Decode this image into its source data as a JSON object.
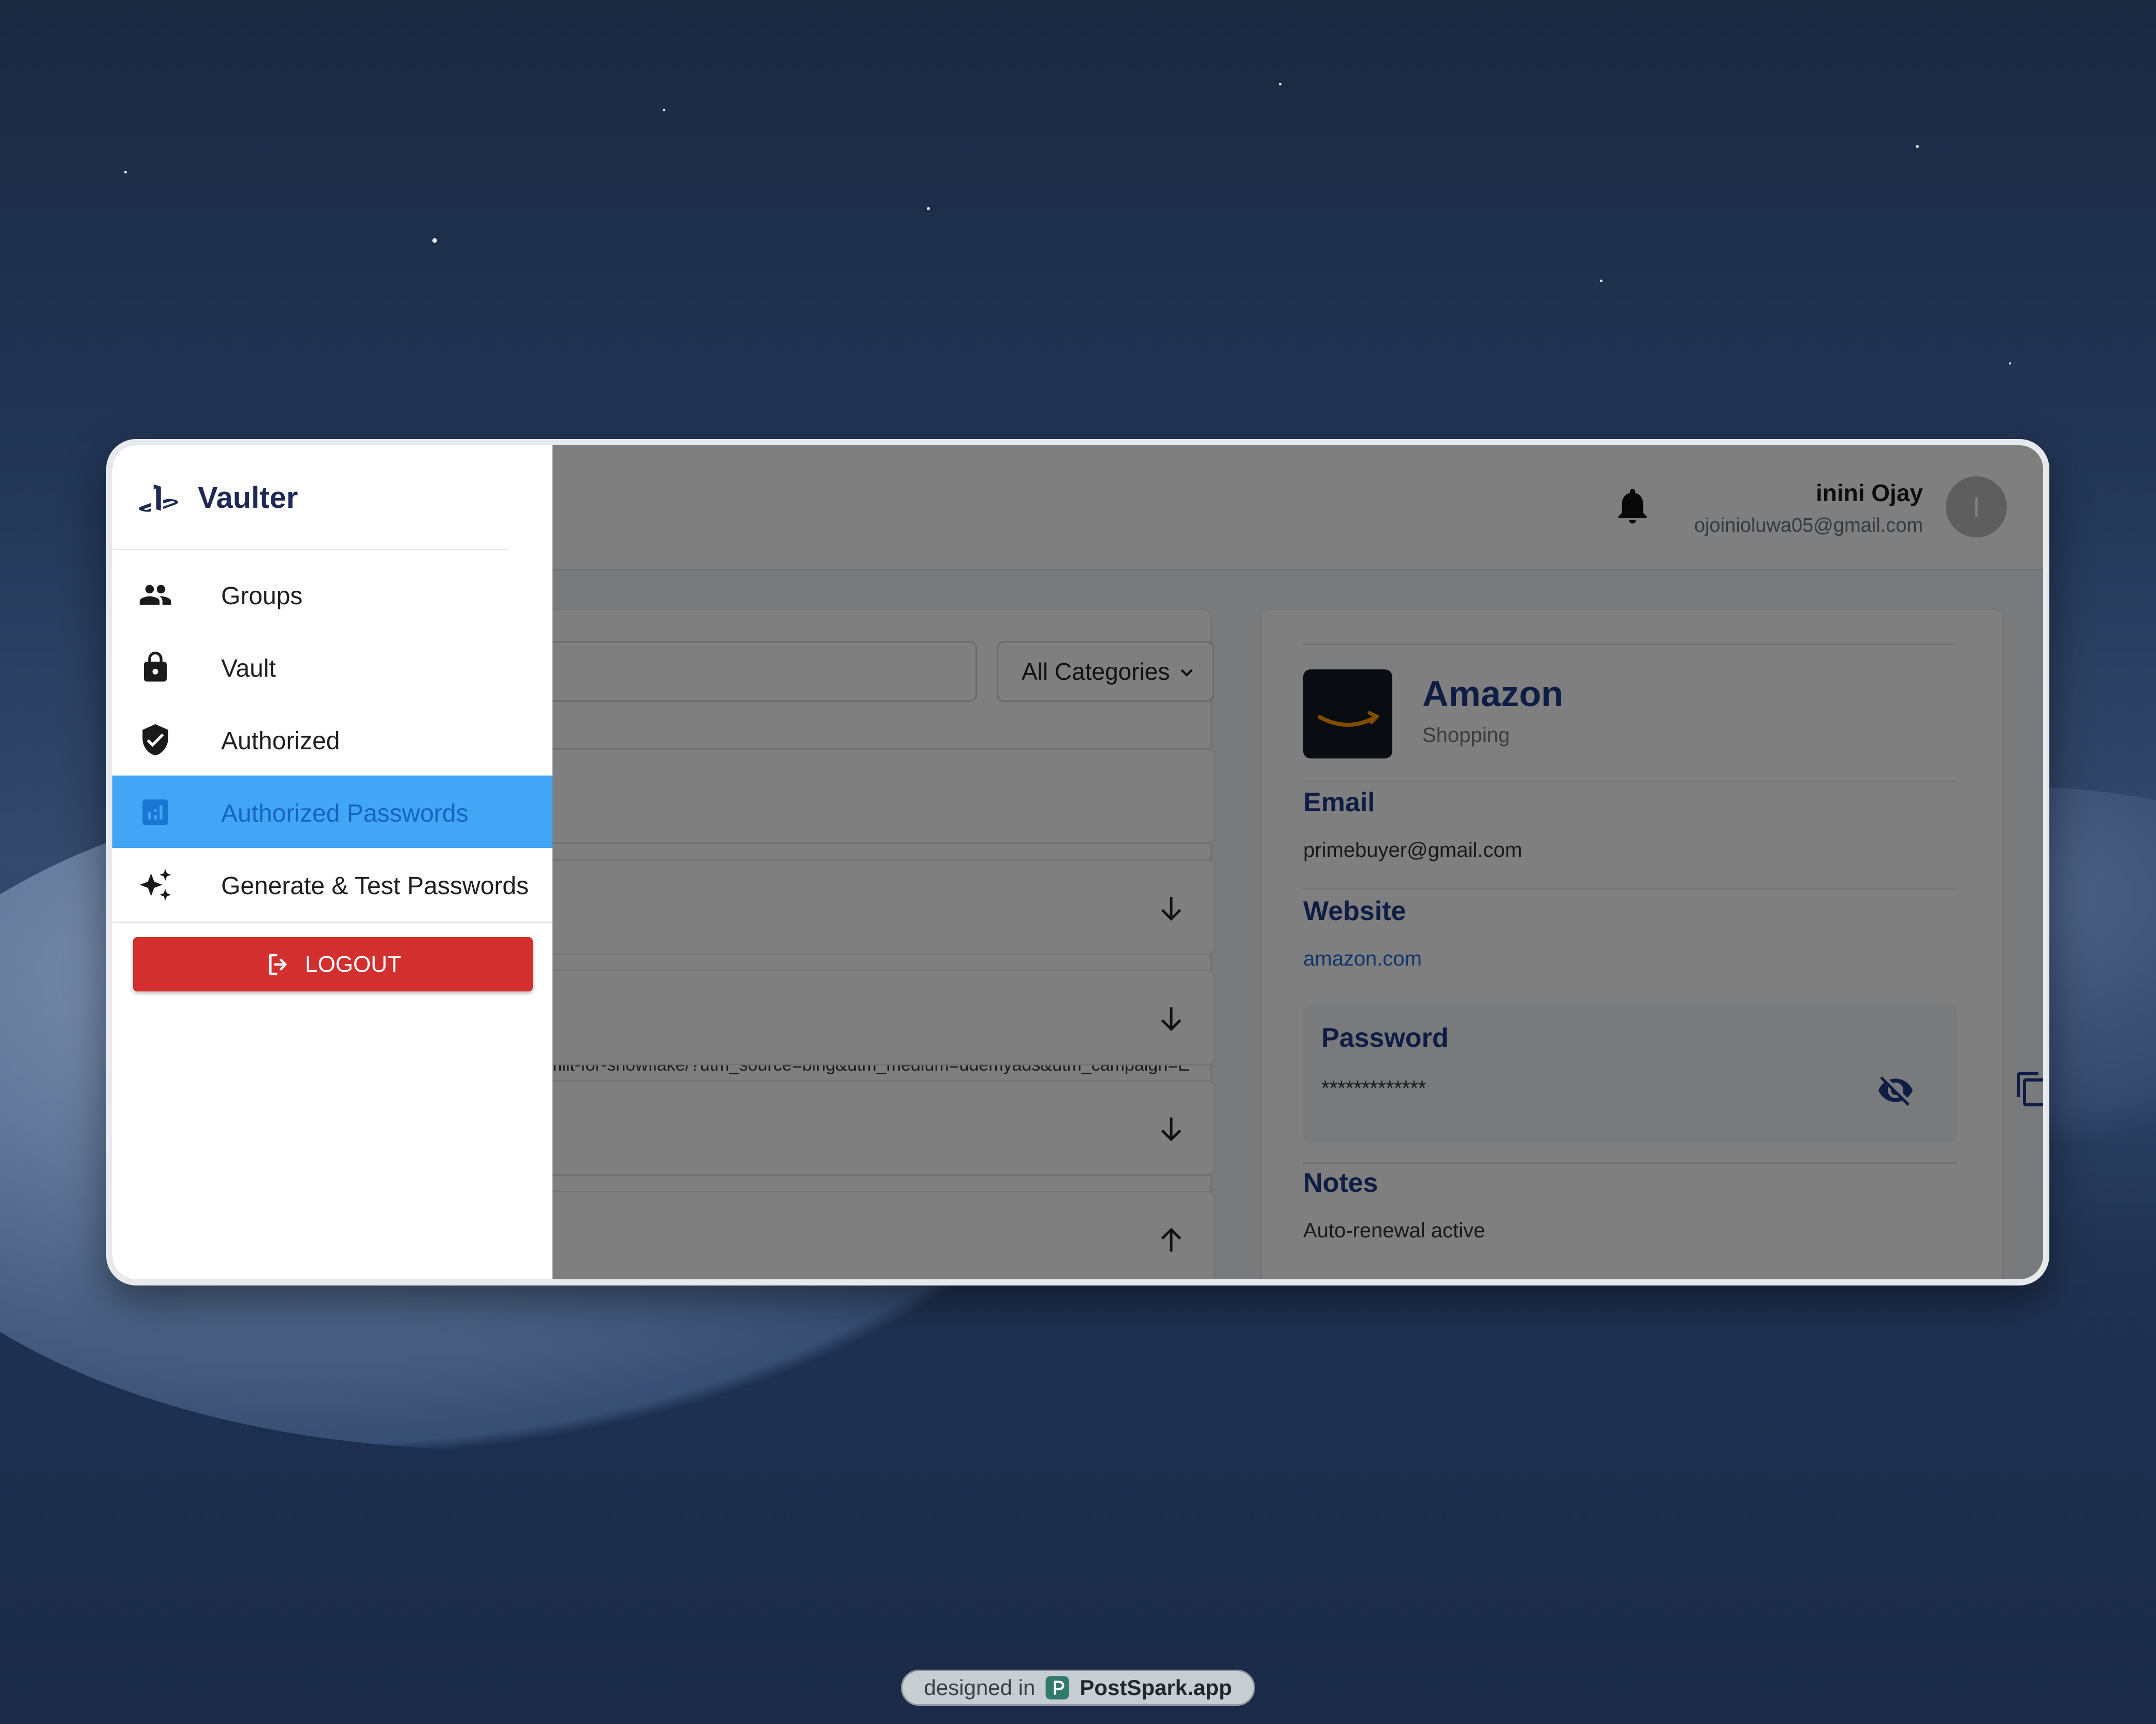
{
  "app": {
    "brand": "Vaulter",
    "user": {
      "name": "inini Ojay",
      "email": "ojoinioluwa05@gmail.com",
      "avatar_initial": "I"
    }
  },
  "sidebar": {
    "items": [
      {
        "label": "Groups",
        "icon": "group-icon"
      },
      {
        "label": "Vault",
        "icon": "lock-icon"
      },
      {
        "label": "Authorized",
        "icon": "verified-shield-icon"
      },
      {
        "label": "Authorized Passwords",
        "icon": "analytics-icon",
        "active": true
      },
      {
        "label": "Generate & Test Passwords",
        "icon": "sparkle-icon"
      }
    ],
    "logout_label": "LOGOUT"
  },
  "list": {
    "category_filter": "All Categories",
    "first_row_url": "mlit-for-snowflake/?utm_source=bing&utm_medium=udemyads&utm_campaign=E"
  },
  "detail": {
    "title": "Amazon",
    "category": "Shopping",
    "email_label": "Email",
    "email_value": "primebuyer@gmail.com",
    "website_label": "Website",
    "website_value": "amazon.com",
    "password_label": "Password",
    "password_value": "*************",
    "notes_label": "Notes",
    "notes_value": "Auto-renewal active"
  },
  "footer_badge": {
    "prefix": "designed in",
    "brand": "PostSpark.app"
  },
  "colors": {
    "accent": "#42a5f5",
    "brand_navy": "#1e3a8a",
    "danger": "#d32f2f"
  }
}
